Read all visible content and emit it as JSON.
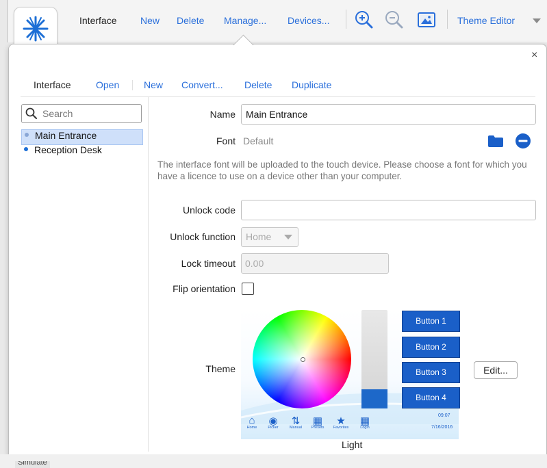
{
  "toolbar": {
    "title": "Interface",
    "new_label": "New",
    "delete_label": "Delete",
    "manage_label": "Manage...",
    "devices_label": "Devices...",
    "theme_editor_label": "Theme Editor"
  },
  "popover": {
    "close_label": "×",
    "tabs": {
      "title": "Interface",
      "open_label": "Open",
      "new_label": "New",
      "convert_label": "Convert...",
      "delete_label": "Delete",
      "duplicate_label": "Duplicate"
    },
    "search": {
      "placeholder": "Search"
    },
    "interfaces": [
      {
        "label": "Main Entrance",
        "selected": true
      },
      {
        "label": "Reception Desk",
        "selected": false
      }
    ],
    "form": {
      "name_label": "Name",
      "name_value": "Main Entrance",
      "font_label": "Font",
      "font_value": "Default",
      "font_note": "The interface font will be uploaded to the touch device. Please choose a font for which you have a licence to use on a device other than your computer.",
      "unlock_code_label": "Unlock code",
      "unlock_code_value": "",
      "unlock_function_label": "Unlock function",
      "unlock_function_value": "Home",
      "lock_timeout_label": "Lock timeout",
      "lock_timeout_value": "0.00",
      "flip_orientation_label": "Flip orientation",
      "flip_orientation_checked": false,
      "theme_label": "Theme",
      "theme_edit_label": "Edit...",
      "theme_name": "Light"
    },
    "theme_preview": {
      "buttons": [
        "Button 1",
        "Button 2",
        "Button 3",
        "Button 4"
      ],
      "tabbar": [
        {
          "icon": "home-icon",
          "label": "Home"
        },
        {
          "icon": "palette-icon",
          "label": "Picker"
        },
        {
          "icon": "sliders-icon",
          "label": "Manual"
        },
        {
          "icon": "grid-icon",
          "label": "Presets"
        },
        {
          "icon": "star-icon",
          "label": "Favorites"
        },
        {
          "icon": "keypad-icon",
          "label": "Login"
        }
      ],
      "time": "09:07",
      "date": "7/16/2016",
      "accent": "#1a5fc8"
    }
  },
  "footer": {
    "simulate_label": "Simulate"
  },
  "colors": {
    "link": "#2a6fdb",
    "accent": "#1a5fc8"
  }
}
